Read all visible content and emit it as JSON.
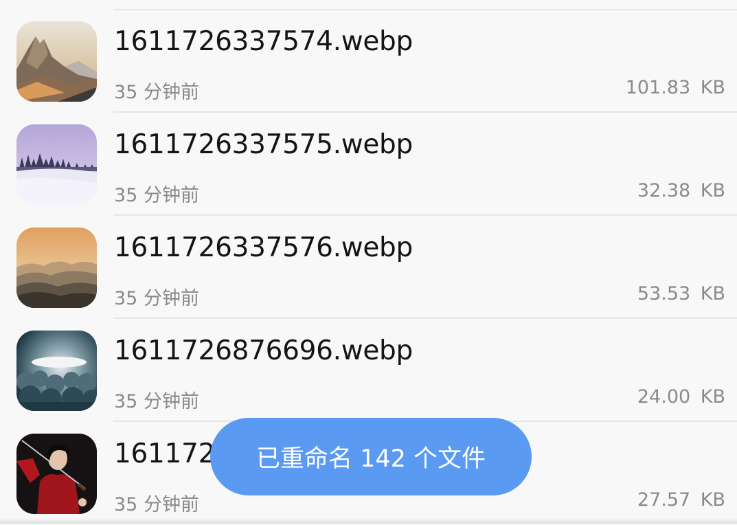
{
  "files": [
    {
      "name": "1611726337574.webp",
      "time": "35 分钟前",
      "size": "101.83 KB",
      "thumb": "mountain-peak-icon"
    },
    {
      "name": "1611726337575.webp",
      "time": "35 分钟前",
      "size": "32.38 KB",
      "thumb": "snow-forest-icon"
    },
    {
      "name": "1611726337576.webp",
      "time": "35 分钟前",
      "size": "53.53 KB",
      "thumb": "misty-hills-icon"
    },
    {
      "name": "1611726876696.webp",
      "time": "35 分钟前",
      "size": "24.00 KB",
      "thumb": "cloudy-sky-icon"
    },
    {
      "name": "1611726",
      "time": "35 分钟前",
      "size": "27.57 KB",
      "thumb": "warrior-portrait-icon"
    }
  ],
  "toast": {
    "message": "已重命名 142 个文件"
  },
  "colors": {
    "background": "#f8f8f8",
    "toast": "#5b9af2",
    "primary_text": "#141414",
    "secondary_text": "#8a8a8a"
  }
}
